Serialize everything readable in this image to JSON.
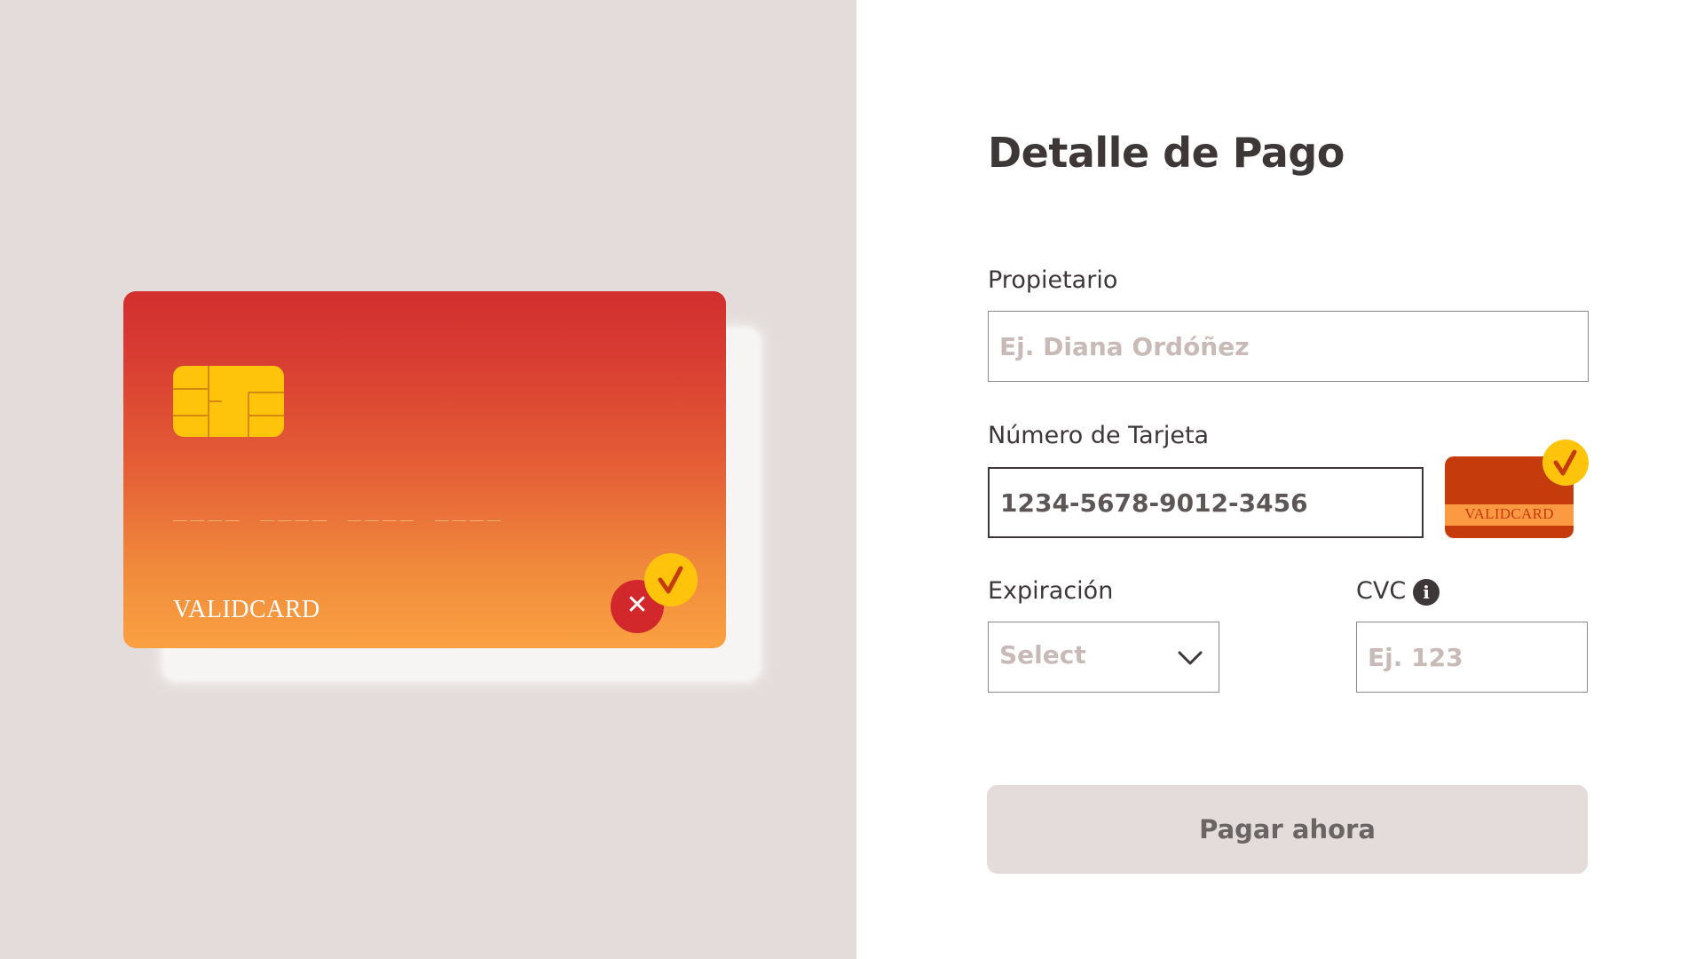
{
  "card_preview": {
    "number_mask": "____  ____  ____  ____",
    "brand": "VALIDCARD",
    "status_icons": [
      "x-icon",
      "check-icon"
    ]
  },
  "form": {
    "title": "Detalle de Pago",
    "owner": {
      "label": "Propietario",
      "placeholder": "Ej. Diana Ordóñez",
      "value": ""
    },
    "card_number": {
      "label": "Número de Tarjeta",
      "value": "1234-5678-9012-3456",
      "brand_badge": "VALIDCARD"
    },
    "expiration": {
      "label": "Expiración",
      "selected": "Select"
    },
    "cvc": {
      "label": "CVC",
      "placeholder": "Ej. 123",
      "value": ""
    },
    "submit_label": "Pagar ahora"
  },
  "colors": {
    "card_gradient_top": "#d22f2f",
    "card_gradient_bottom": "#fba142",
    "chip": "#fec40c",
    "error": "#d2272b",
    "text_dark": "#3d3737",
    "placeholder": "#c8bab6",
    "left_bg": "#e3dcda"
  }
}
